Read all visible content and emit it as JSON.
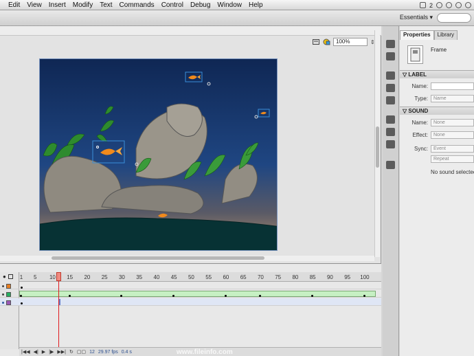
{
  "menubar": {
    "items": [
      "Edit",
      "View",
      "Insert",
      "Modify",
      "Text",
      "Commands",
      "Control",
      "Debug",
      "Window",
      "Help"
    ],
    "right_badge": "2"
  },
  "workspace": {
    "selector": "Essentials",
    "arrow": "▾"
  },
  "stage": {
    "zoom": "100%",
    "colors": {
      "water_top": "#102a58",
      "water_bottom": "#a08a6a",
      "ground": "#073234"
    }
  },
  "timeline": {
    "frame_labels": [
      "1",
      "5",
      "10",
      "15",
      "20",
      "25",
      "30",
      "35",
      "40",
      "45",
      "50",
      "55",
      "60",
      "65",
      "70",
      "75",
      "80",
      "85",
      "90",
      "95",
      "100"
    ],
    "current_frame": "12",
    "fps": "29.97 fps",
    "time": "0.4 s",
    "layer_colors": [
      "#e67e22",
      "#27ae60",
      "#9b59b6"
    ]
  },
  "properties": {
    "tabs": [
      "Properties",
      "Library"
    ],
    "object_type": "Frame",
    "sections": {
      "label": "LABEL",
      "sound": "SOUND"
    },
    "fields": {
      "name_label": "Name:",
      "type_label": "Type:",
      "type_value": "Name",
      "sound_name_label": "Name:",
      "sound_name_value": "None",
      "effect_label": "Effect:",
      "effect_value": "None",
      "sync_label": "Sync:",
      "sync_value": "Event",
      "repeat_value": "Repeat",
      "no_sound": "No sound selected"
    }
  },
  "watermark": "www.fileinfo.com"
}
